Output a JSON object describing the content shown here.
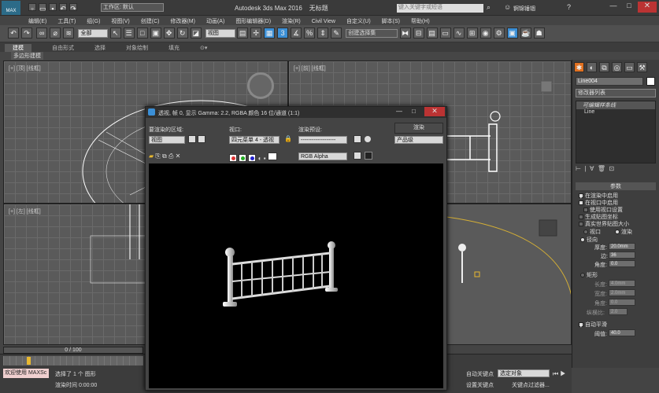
{
  "app": {
    "title": "Autodesk 3ds Max 2016",
    "file": "无标题",
    "workspace": "工作区: 默认",
    "search_placeholder": "键入关键字或短语",
    "user": "锕锦锤锢",
    "logo": "MAX"
  },
  "menu": [
    "编辑(E)",
    "工具(T)",
    "组(G)",
    "视图(V)",
    "创建(C)",
    "修改器(M)",
    "动画(A)",
    "图形编辑器(D)",
    "渲染(R)",
    "Civil View",
    "自定义(U)",
    "脚本(S)",
    "帮助(H)"
  ],
  "toolbar": {
    "filter": "全部",
    "refcoord": "视图",
    "selection_set": "创建选择集"
  },
  "ribbon": {
    "tabs": [
      "建模",
      "自由形式",
      "选择",
      "对象绘制",
      "填充"
    ],
    "sub": "多边形建模"
  },
  "viewports": {
    "top": "[+] [顶] [线框]",
    "front": "[+] [前] [线框]",
    "left": "[+] [左] [线框]"
  },
  "render_dialog": {
    "title": "透视, 帧 0, 显示 Gamma: 2.2, RGBA 颜色 16 位/通道 (1:1)",
    "area_label": "要渲染的区域:",
    "area_value": "视图",
    "viewport_label": "视口:",
    "viewport_value": "四元菜单 4 - 透视",
    "preset_label": "渲染预设:",
    "preset_value": "-------------------",
    "render_button": "渲染",
    "quality": "产品级",
    "channel": "RGB Alpha"
  },
  "cmdpanel": {
    "object_name": "Line004",
    "modifier_list": "修改器列表",
    "stack": [
      "可编辑样条线",
      "Line"
    ],
    "rollout": "参数",
    "options": [
      {
        "label": "在渲染中启用",
        "checked": true
      },
      {
        "label": "在视口中启用",
        "checked": true
      },
      {
        "label": "使用视口设置",
        "checked": false
      },
      {
        "label": "生成贴图坐标",
        "checked": false
      },
      {
        "label": "真实世界贴图大小",
        "checked": false
      }
    ],
    "viewport_radio": "视口",
    "render_radio": "渲染",
    "radial": "径向",
    "thickness_label": "厚度:",
    "thickness": "20.0mm",
    "sides_label": "边:",
    "sides": "36",
    "angle_label": "角度:",
    "angle": "0.0",
    "rect": "矩形",
    "length_label": "长度:",
    "length": "4.0mm",
    "width_label": "宽度:",
    "width": "2.0mm",
    "rangle_label": "角度:",
    "rangle": "0.0",
    "aspect_label": "纵横比:",
    "aspect": "2.0",
    "autosmooth": "自动平滑",
    "threshold_label": "阈值:",
    "threshold": "40.0"
  },
  "status": {
    "progress": "0 / 100",
    "maxscript": "欢迎使用 MAXSc",
    "selected": "选择了 1 个 图形",
    "render_time": "渲染时间 0:00:00",
    "autokey": "自动关键点",
    "selobj": "选定对象",
    "setkey": "设置关键点",
    "keyfilter": "关键点过滤器..."
  },
  "colors": {
    "accent": "#3b8fd6",
    "selection": "#e8b830"
  }
}
